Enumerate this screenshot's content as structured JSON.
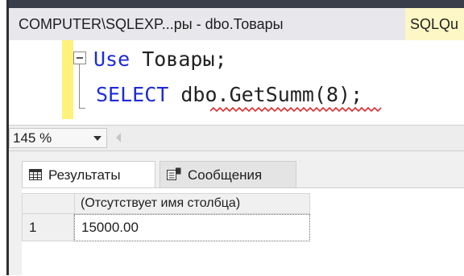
{
  "window": {
    "active_tab_title": "COMPUTER\\SQLEXP...ры - dbo.Товары",
    "next_tab_title": "SQLQu"
  },
  "editor": {
    "line1_keyword": "Use",
    "line1_rest": " Товары;",
    "line2_keyword": "SELECT",
    "line2_rest": " dbo.GetSumm(8);",
    "error_squiggle_on": "dbo.GetSumm"
  },
  "zoom": {
    "value": "145 %"
  },
  "results_tabs": [
    {
      "label": "Результаты",
      "icon": "grid-icon",
      "active": true
    },
    {
      "label": "Сообщения",
      "icon": "messages-icon",
      "active": false
    }
  ],
  "grid": {
    "column_header": "(Отсутствует имя столбца)",
    "rows": [
      {
        "row_number": "1",
        "value": "15000.00"
      }
    ]
  },
  "colors": {
    "keyword": "#1f2bd8",
    "tab_bar": "#3a3d4a",
    "change_margin": "#fff27a",
    "squiggle": "#d83131"
  }
}
